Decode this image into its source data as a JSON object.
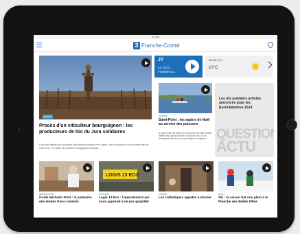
{
  "status_bar": {
    "time": "11:15"
  },
  "header": {
    "brand": "Franche-Comté",
    "logo_letter": "3"
  },
  "lead": {
    "tag": "justice",
    "title": "Procès d'un viticulteur bourguignon : les producteurs de bio du Jura solidaires",
    "body": "C'est une affaire qui fait grand bruit dans le monde de la vigne, celle du procès d'un viticulteur bio de Côte d'Or. Ce matin, un confrère bourguignon pourrait..."
  },
  "jt": {
    "label": "JT",
    "line1": "Le 12/13",
    "line2": "Franche-Co..."
  },
  "weather": {
    "city": "Besançon",
    "temp": "10°C"
  },
  "article2": {
    "category": "société",
    "title": "Saint-Point : les sapins de Noël au service des poissons",
    "body": "A Saint-Point, les pêcheurs ont trouvé une idée inédite : mettre des sapins de Noël au fond de l'eau. Ils se rechargent dans le lac pour protéger les frayères..."
  },
  "promo": {
    "text": "Les dix premiers artistes annoncés pour les Eurockéennes 2014",
    "big1": "QUESTION",
    "big2": "ACTU"
  },
  "bottom": [
    {
      "category": "gastronomie",
      "title": "Guide Michelin 2014 : le palmarès des étoilés franc-comtois"
    },
    {
      "category": "écologie",
      "title": "Logis 13 Eco : l'appartement qui vous apprend à ne pas gaspiller"
    },
    {
      "category": "religion",
      "title": "Les catholiques appelés à donner"
    },
    {
      "category": "sport",
      "title": "Ski : la saison bat son plein à la Planche des Belles Filles"
    }
  ],
  "thumb_signs": {
    "logis": "LOGIS 13 ECO"
  },
  "colors": {
    "brand": "#2b6bb6",
    "jt_bg": "#1c6fb9",
    "tag": "#3aa0c8"
  }
}
